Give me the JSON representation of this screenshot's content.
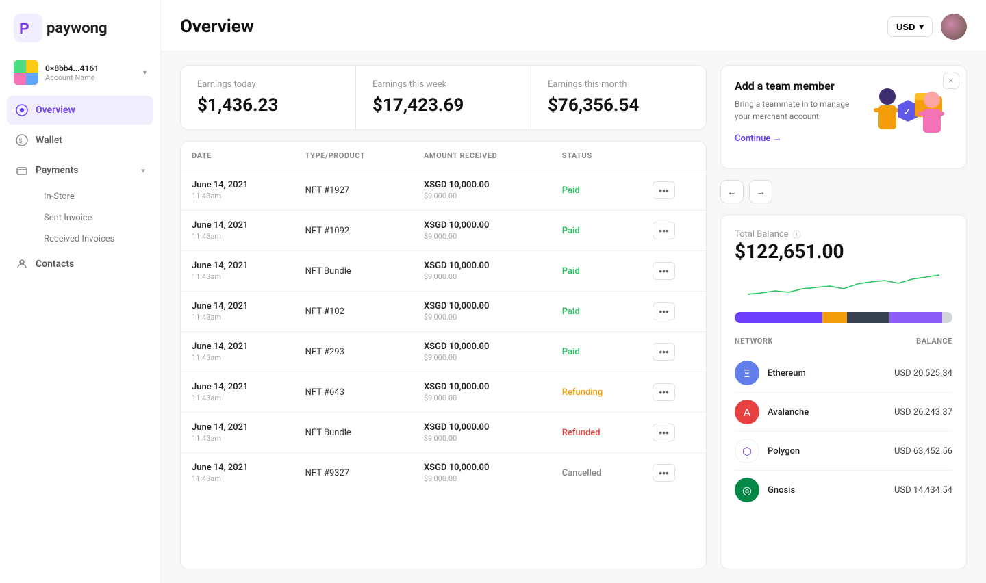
{
  "app": {
    "name": "paywong",
    "logo_text": "paywong"
  },
  "account": {
    "address": "0×8bb4...4161",
    "name": "Account Name"
  },
  "currency": {
    "selected": "USD"
  },
  "nav": {
    "items": [
      {
        "id": "overview",
        "label": "Overview",
        "icon": "overview",
        "active": true
      },
      {
        "id": "wallet",
        "label": "Wallet",
        "icon": "wallet",
        "active": false
      },
      {
        "id": "payments",
        "label": "Payments",
        "icon": "payments",
        "active": false,
        "has_sub": true
      },
      {
        "id": "contacts",
        "label": "Contacts",
        "icon": "contacts",
        "active": false
      }
    ],
    "sub_items": [
      {
        "id": "in-store",
        "label": "In-Store",
        "active": false
      },
      {
        "id": "sent-invoice",
        "label": "Sent Invoice",
        "active": false
      },
      {
        "id": "received-invoices",
        "label": "Received Invoices",
        "active": false
      }
    ]
  },
  "header": {
    "title": "Overview"
  },
  "earnings": [
    {
      "label": "Earnings today",
      "value": "$1,436.23"
    },
    {
      "label": "Earnings this week",
      "value": "$17,423.69"
    },
    {
      "label": "Earnings this month",
      "value": "$76,356.54"
    }
  ],
  "table": {
    "columns": [
      "DATE",
      "TYPE/PRODUCT",
      "AMOUNT RECEIVED",
      "STATUS"
    ],
    "rows": [
      {
        "date": "June 14, 2021",
        "time": "11:43am",
        "product": "NFT #1927",
        "amount_crypto": "XSGD 10,000.00",
        "amount_usd": "$9,000.00",
        "status": "Paid",
        "status_class": "paid"
      },
      {
        "date": "June 14, 2021",
        "time": "11:43am",
        "product": "NFT #1092",
        "amount_crypto": "XSGD 10,000.00",
        "amount_usd": "$9,000.00",
        "status": "Paid",
        "status_class": "paid"
      },
      {
        "date": "June 14, 2021",
        "time": "11:43am",
        "product": "NFT Bundle",
        "amount_crypto": "XSGD 10,000.00",
        "amount_usd": "$9,000.00",
        "status": "Paid",
        "status_class": "paid"
      },
      {
        "date": "June 14, 2021",
        "time": "11:43am",
        "product": "NFT #102",
        "amount_crypto": "XSGD 10,000.00",
        "amount_usd": "$9,000.00",
        "status": "Paid",
        "status_class": "paid"
      },
      {
        "date": "June 14, 2021",
        "time": "11:43am",
        "product": "NFT #293",
        "amount_crypto": "XSGD 10,000.00",
        "amount_usd": "$9,000.00",
        "status": "Paid",
        "status_class": "paid"
      },
      {
        "date": "June 14, 2021",
        "time": "11:43am",
        "product": "NFT #643",
        "amount_crypto": "XSGD 10,000.00",
        "amount_usd": "$9,000.00",
        "status": "Refunding",
        "status_class": "refunding"
      },
      {
        "date": "June 14, 2021",
        "time": "11:43am",
        "product": "NFT Bundle",
        "amount_crypto": "XSGD 10,000.00",
        "amount_usd": "$9,000.00",
        "status": "Refunded",
        "status_class": "refunded"
      },
      {
        "date": "June 14, 2021",
        "time": "11:43am",
        "product": "NFT #9327",
        "amount_crypto": "XSGD 10,000.00",
        "amount_usd": "$9,000.00",
        "status": "Cancelled",
        "status_class": "cancelled"
      }
    ]
  },
  "promo": {
    "title": "Add a team member",
    "description": "Bring a teammate in to manage your merchant account",
    "cta": "Continue →",
    "close_label": "×"
  },
  "carousel": {
    "prev_label": "←",
    "next_label": "→"
  },
  "balance": {
    "label": "Total Balance",
    "value": "$122,651.00",
    "networks": [
      {
        "id": "ethereum",
        "name": "Ethereum",
        "balance": "USD 20,525.34",
        "icon_class": "eth-icon",
        "symbol": "Ξ"
      },
      {
        "id": "avalanche",
        "name": "Avalanche",
        "balance": "USD 26,243.37",
        "icon_class": "avax-icon",
        "symbol": "A"
      },
      {
        "id": "polygon",
        "name": "Polygon",
        "balance": "USD 63,452.56",
        "icon_class": "matic-icon",
        "symbol": "⬡"
      },
      {
        "id": "gnosis",
        "name": "Gnosis",
        "balance": "USD 14,434.54",
        "icon_class": "gnosis-icon",
        "symbol": "◎"
      }
    ]
  }
}
